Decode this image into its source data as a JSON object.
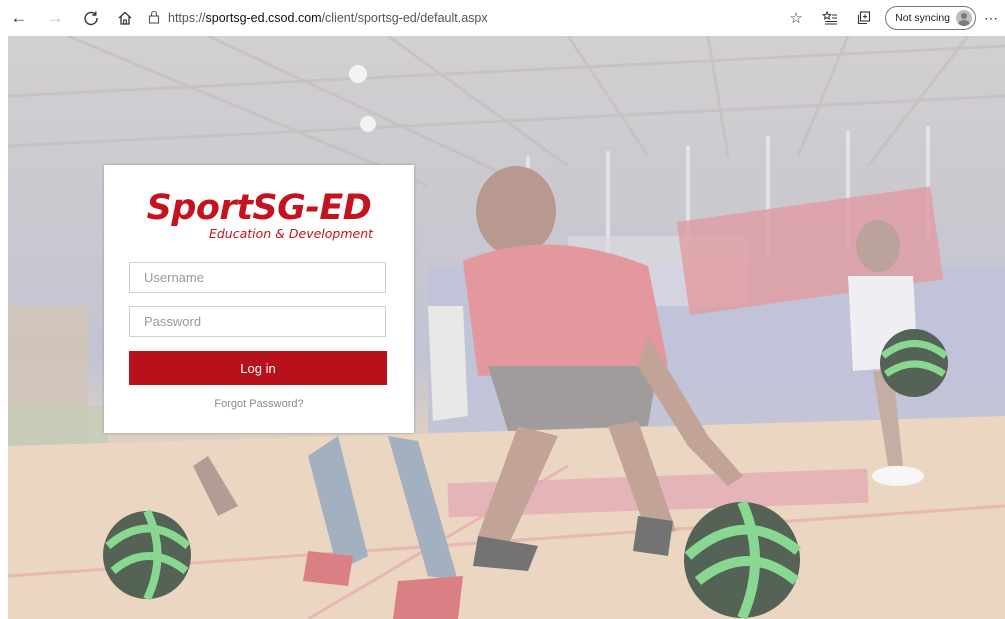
{
  "browser": {
    "url_scheme": "https://",
    "url_host": "sportsg-ed.csod.com",
    "url_path": "/client/sportsg-ed/default.aspx",
    "sync_status": "Not syncing",
    "icons": [
      "back-icon",
      "forward-icon",
      "refresh-icon",
      "home-icon",
      "lock-icon",
      "favorite-star-icon",
      "favorites-list-icon",
      "collections-icon",
      "profile-avatar-icon",
      "more-icon"
    ]
  },
  "login": {
    "brand_title": "SportSG-ED",
    "brand_subtitle": "Education & Development",
    "username_placeholder": "Username",
    "password_placeholder": "Password",
    "login_label": "Log in",
    "forgot_label": "Forgot Password?"
  },
  "colors": {
    "brand_red": "#c4131e",
    "button_red": "#b8111b"
  }
}
